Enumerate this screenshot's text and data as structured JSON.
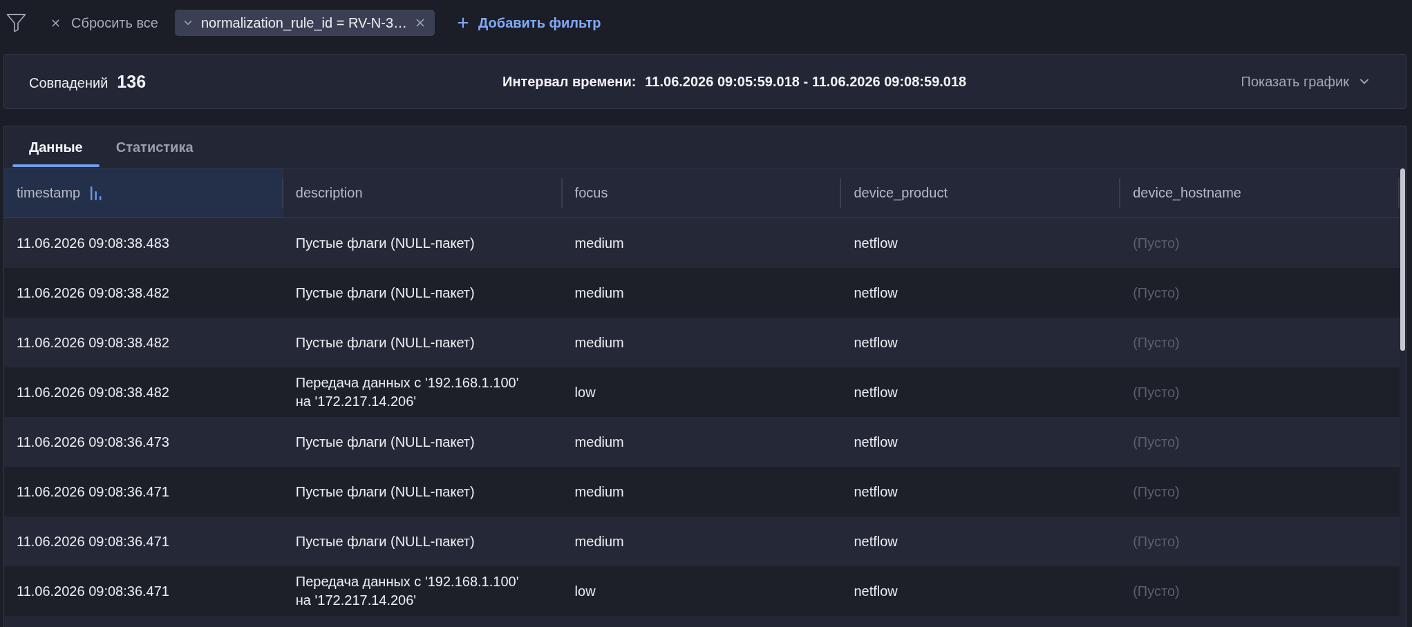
{
  "filter_bar": {
    "reset_label": "Сбросить все",
    "chips": [
      {
        "label": "normalization_rule_id = RV-N-3…"
      }
    ],
    "add_label": "Добавить фильтр"
  },
  "summary": {
    "matches_label": "Совпадений",
    "matches_count": "136",
    "interval_label": "Интервал времени:",
    "interval_value": "11.06.2026 09:05:59.018 - 11.06.2026 09:08:59.018",
    "chart_toggle_label": "Показать график"
  },
  "tabs": [
    {
      "label": "Данные",
      "selected": true
    },
    {
      "label": "Статистика",
      "selected": false
    }
  ],
  "table": {
    "columns": [
      {
        "label": "timestamp",
        "sorted": true
      },
      {
        "label": "description",
        "sorted": false
      },
      {
        "label": "focus",
        "sorted": false
      },
      {
        "label": "device_product",
        "sorted": false
      },
      {
        "label": "device_hostname",
        "sorted": false
      }
    ],
    "rows": [
      {
        "cells": [
          {
            "text": "11.06.2026 09:08:38.483",
            "empty": false
          },
          {
            "text": "Пустые флаги (NULL-пакет)",
            "empty": false
          },
          {
            "text": "medium",
            "empty": false
          },
          {
            "text": "netflow",
            "empty": false
          },
          {
            "text": "(Пусто)",
            "empty": true
          }
        ]
      },
      {
        "cells": [
          {
            "text": "11.06.2026 09:08:38.482",
            "empty": false
          },
          {
            "text": "Пустые флаги (NULL-пакет)",
            "empty": false
          },
          {
            "text": "medium",
            "empty": false
          },
          {
            "text": "netflow",
            "empty": false
          },
          {
            "text": "(Пусто)",
            "empty": true
          }
        ]
      },
      {
        "cells": [
          {
            "text": "11.06.2026 09:08:38.482",
            "empty": false
          },
          {
            "text": "Пустые флаги (NULL-пакет)",
            "empty": false
          },
          {
            "text": "medium",
            "empty": false
          },
          {
            "text": "netflow",
            "empty": false
          },
          {
            "text": "(Пусто)",
            "empty": true
          }
        ]
      },
      {
        "cells": [
          {
            "text": "11.06.2026 09:08:38.482",
            "empty": false
          },
          {
            "text": "Передача данных с '192.168.1.100' на '172.217.14.206'",
            "empty": false
          },
          {
            "text": "low",
            "empty": false
          },
          {
            "text": "netflow",
            "empty": false
          },
          {
            "text": "(Пусто)",
            "empty": true
          }
        ]
      },
      {
        "cells": [
          {
            "text": "11.06.2026 09:08:36.473",
            "empty": false
          },
          {
            "text": "Пустые флаги (NULL-пакет)",
            "empty": false
          },
          {
            "text": "medium",
            "empty": false
          },
          {
            "text": "netflow",
            "empty": false
          },
          {
            "text": "(Пусто)",
            "empty": true
          }
        ]
      },
      {
        "cells": [
          {
            "text": "11.06.2026 09:08:36.471",
            "empty": false
          },
          {
            "text": "Пустые флаги (NULL-пакет)",
            "empty": false
          },
          {
            "text": "medium",
            "empty": false
          },
          {
            "text": "netflow",
            "empty": false
          },
          {
            "text": "(Пусто)",
            "empty": true
          }
        ]
      },
      {
        "cells": [
          {
            "text": "11.06.2026 09:08:36.471",
            "empty": false
          },
          {
            "text": "Пустые флаги (NULL-пакет)",
            "empty": false
          },
          {
            "text": "medium",
            "empty": false
          },
          {
            "text": "netflow",
            "empty": false
          },
          {
            "text": "(Пусто)",
            "empty": true
          }
        ]
      },
      {
        "cells": [
          {
            "text": "11.06.2026 09:08:36.471",
            "empty": false
          },
          {
            "text": "Передача данных с '192.168.1.100' на '172.217.14.206'",
            "empty": false
          },
          {
            "text": "low",
            "empty": false
          },
          {
            "text": "netflow",
            "empty": false
          },
          {
            "text": "(Пусто)",
            "empty": true
          }
        ]
      }
    ]
  }
}
